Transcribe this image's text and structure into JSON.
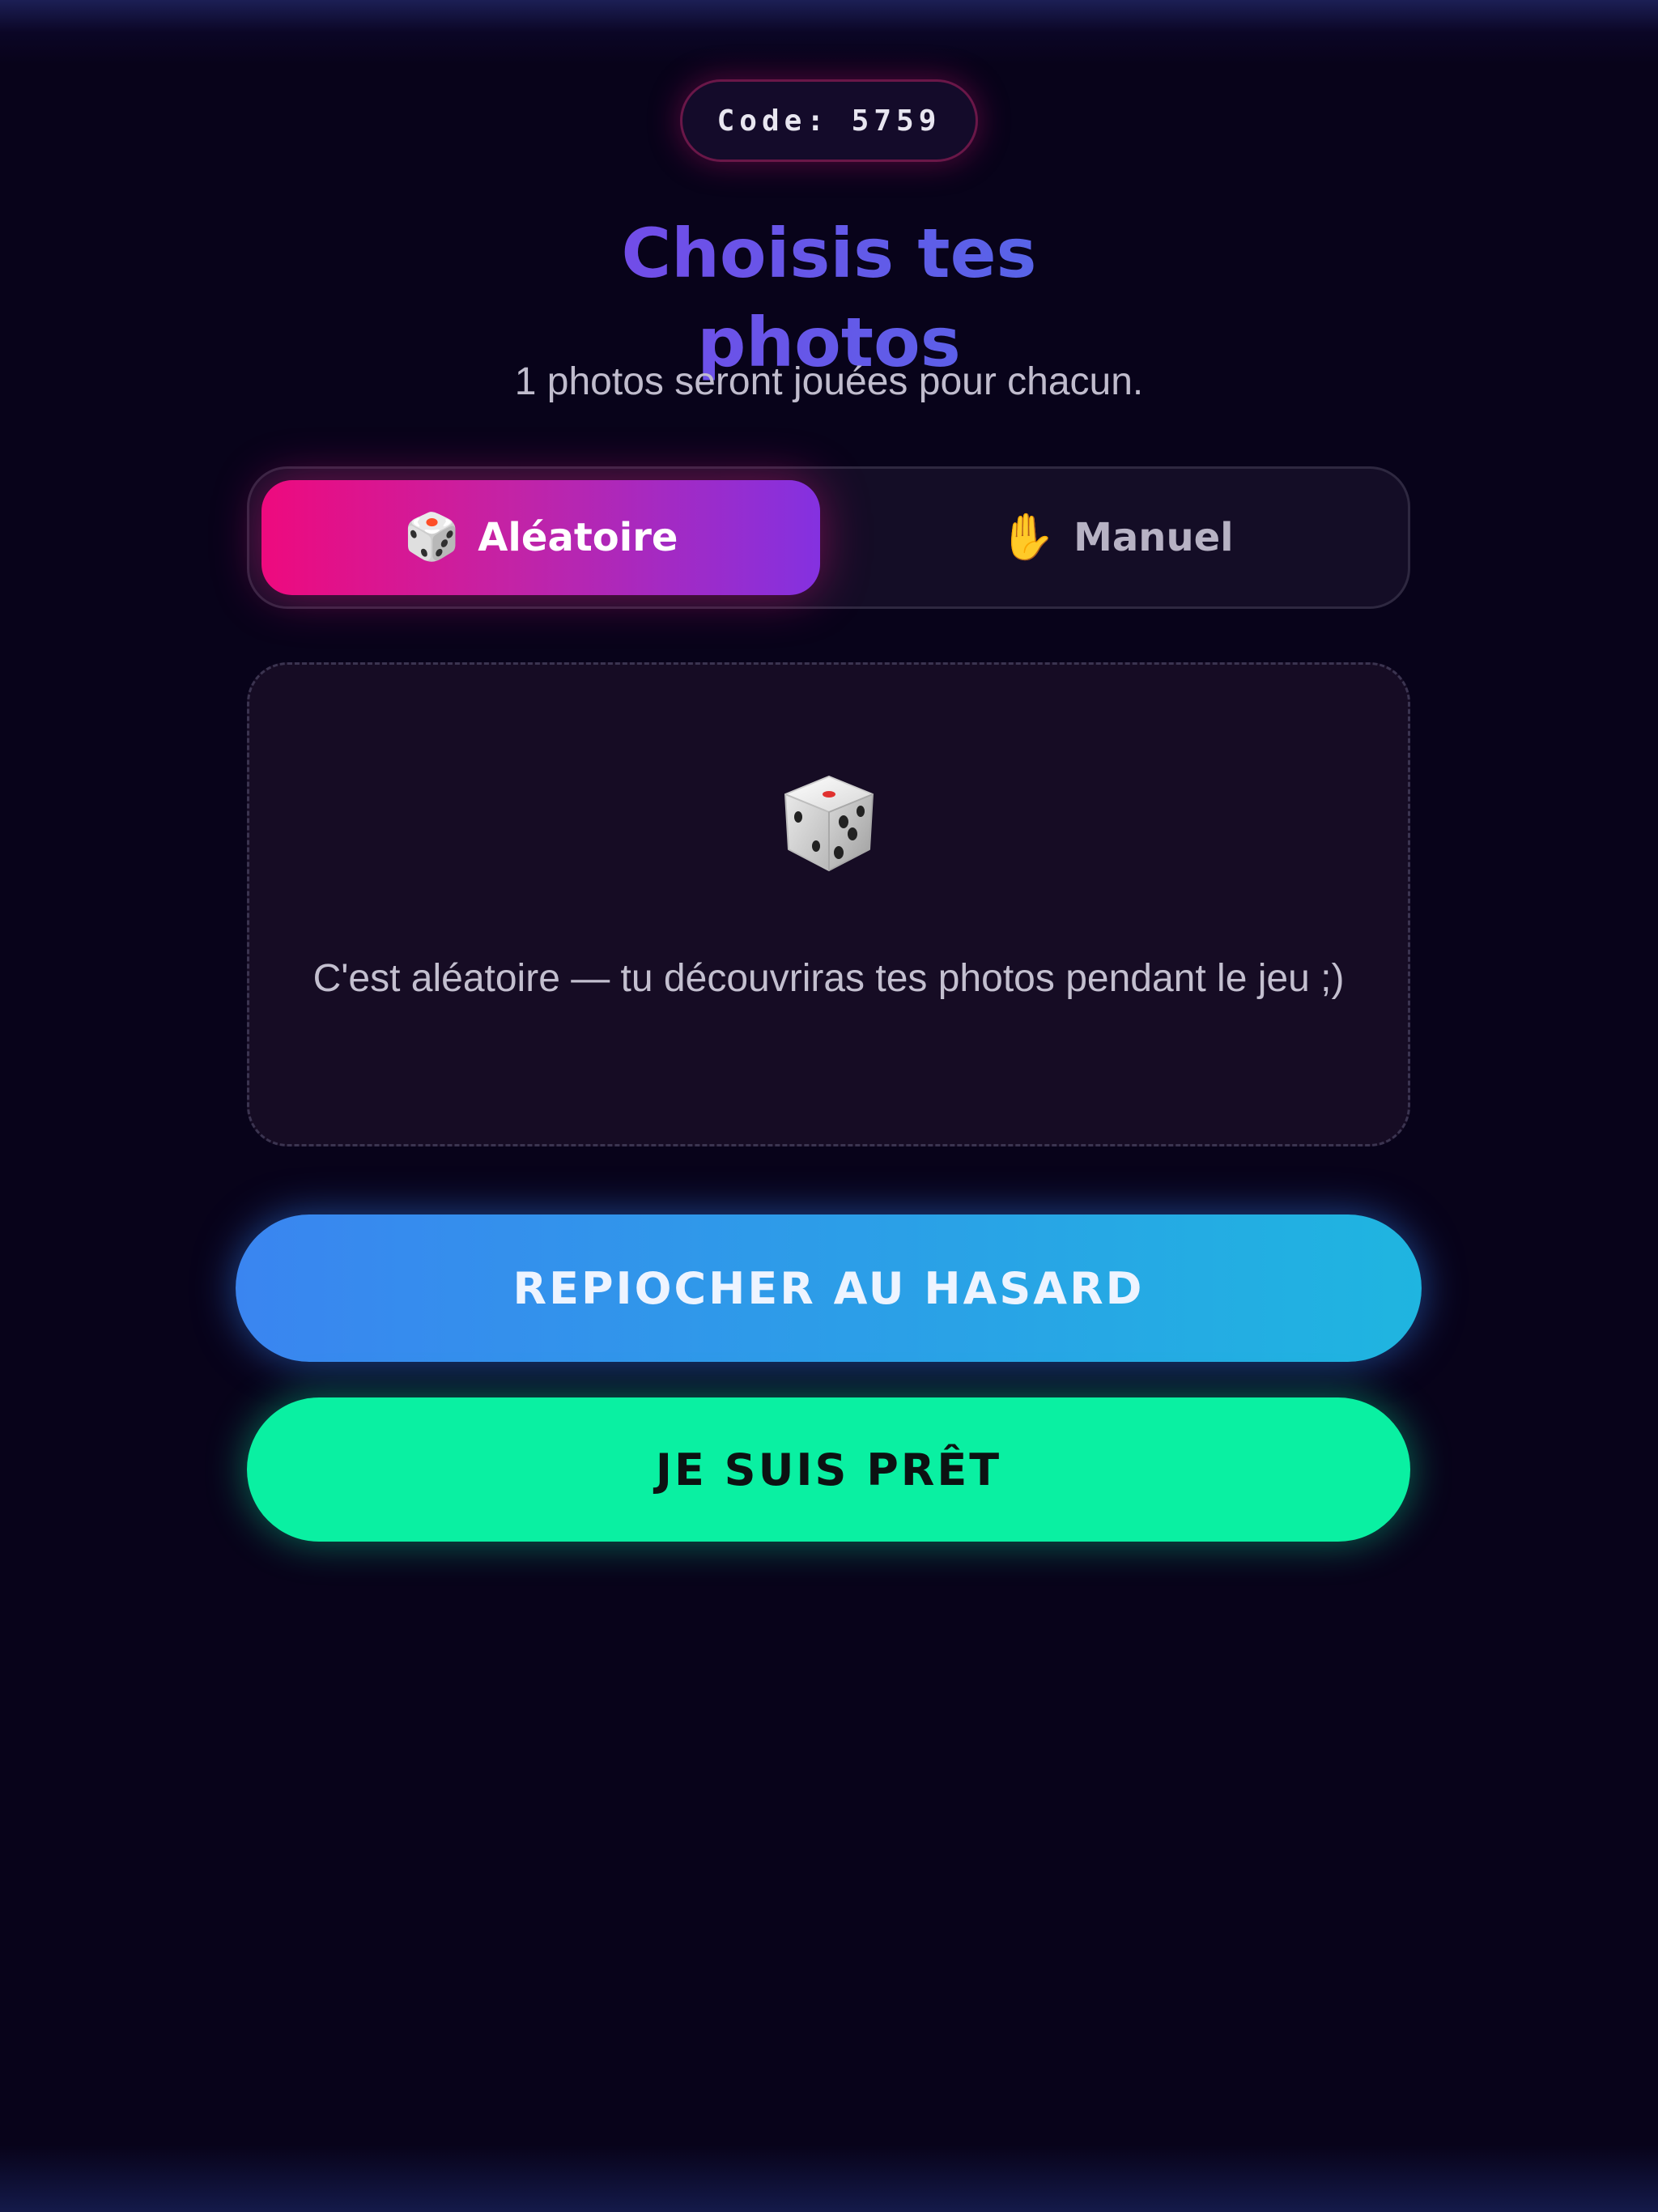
{
  "header": {
    "code_label": "Code: 5759"
  },
  "main": {
    "title": "Choisis tes photos",
    "subtitle": "1 photos seront jouées pour chacun."
  },
  "mode_toggle": {
    "options": [
      {
        "icon": "🎲",
        "icon_name": "dice-icon",
        "label": "Aléatoire",
        "active": true
      },
      {
        "icon": "✋",
        "icon_name": "raised-hand-icon",
        "label": "Manuel",
        "active": false
      }
    ]
  },
  "info_card": {
    "icon_name": "dice-icon",
    "text": "C'est aléatoire — tu découvriras tes photos pendant le jeu ;)"
  },
  "actions": {
    "reroll_label": "REPIOCHER AU HASARD",
    "ready_label": "JE SUIS PRÊT"
  },
  "colors": {
    "background": "#08031a",
    "accent_pink": "#ee0a7e",
    "accent_purple": "#8431e0",
    "title_purple": "#6a55e6",
    "reroll_blue": "#3a85f0",
    "ready_green": "#0af0a2"
  }
}
